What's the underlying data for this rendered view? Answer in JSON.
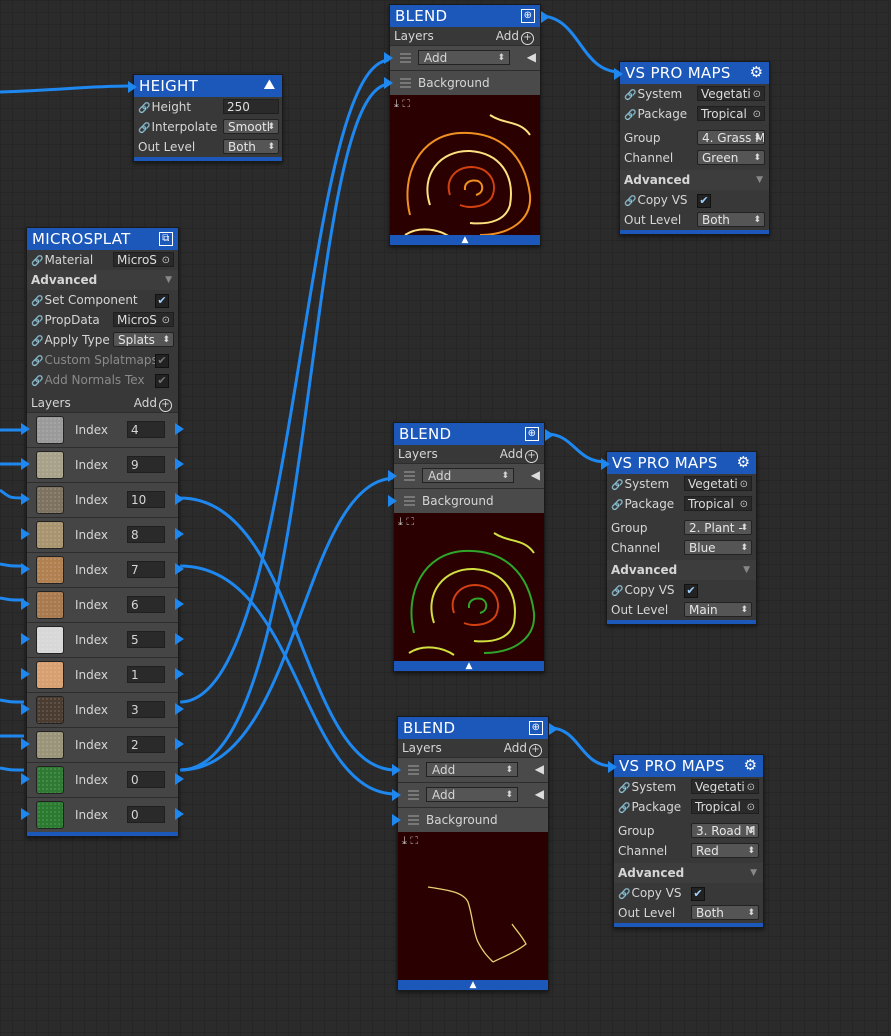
{
  "colors": {
    "accent": "#1b58ba",
    "wire": "#1e88f0",
    "canvas": "#2b2b2b"
  },
  "height_node": {
    "title": "HEIGHT",
    "height_label": "Height",
    "height_value": "250",
    "interpolate_label": "Interpolate",
    "interpolate_value": "Smootl",
    "outlevel_label": "Out Level",
    "outlevel_value": "Both"
  },
  "microsplat": {
    "title": "MICROSPLAT",
    "material_label": "Material",
    "material_value": "MicroS",
    "advanced_label": "Advanced",
    "set_component_label": "Set Component",
    "propdata_label": "PropData",
    "propdata_value": "MicroS",
    "apply_type_label": "Apply Type",
    "apply_type_value": "Splats",
    "custom_splatmaps_label": "Custom Splatmaps",
    "add_normals_label": "Add Normals Tex",
    "layers_label": "Layers",
    "add_label": "Add",
    "index_label": "Index",
    "layers": [
      {
        "index": "4",
        "color": "#9a9a9a"
      },
      {
        "index": "9",
        "color": "#a8a18a"
      },
      {
        "index": "10",
        "color": "#7d7260"
      },
      {
        "index": "8",
        "color": "#a8946e"
      },
      {
        "index": "7",
        "color": "#b08050"
      },
      {
        "index": "6",
        "color": "#a87a4e"
      },
      {
        "index": "5",
        "color": "#d8d8d8"
      },
      {
        "index": "1",
        "color": "#d8a070"
      },
      {
        "index": "3",
        "color": "#4a3c30"
      },
      {
        "index": "2",
        "color": "#9a9478"
      },
      {
        "index": "0",
        "color": "#2e7a32"
      },
      {
        "index": "0",
        "color": "#2a7a30"
      }
    ]
  },
  "blend_nodes": [
    {
      "title": "BLEND",
      "layers_label": "Layers",
      "add_label": "Add",
      "layer_rows": [
        "Add"
      ],
      "background_label": "Background"
    },
    {
      "title": "BLEND",
      "layers_label": "Layers",
      "add_label": "Add",
      "layer_rows": [
        "Add"
      ],
      "background_label": "Background"
    },
    {
      "title": "BLEND",
      "layers_label": "Layers",
      "add_label": "Add",
      "layer_rows": [
        "Add",
        "Add"
      ],
      "background_label": "Background"
    }
  ],
  "vs_nodes": [
    {
      "title": "VS PRO MAPS",
      "system_label": "System",
      "system_value": "Vegetati",
      "package_label": "Package",
      "package_value": "Tropical",
      "group_label": "Group",
      "group_value": "4. Grass M",
      "channel_label": "Channel",
      "channel_value": "Green",
      "advanced_label": "Advanced",
      "copy_label": "Copy VS",
      "outlevel_label": "Out Level",
      "outlevel_value": "Both"
    },
    {
      "title": "VS PRO MAPS",
      "system_label": "System",
      "system_value": "Vegetati",
      "package_label": "Package",
      "package_value": "Tropical",
      "group_label": "Group",
      "group_value": "2. Plant - ",
      "channel_label": "Channel",
      "channel_value": "Blue",
      "advanced_label": "Advanced",
      "copy_label": "Copy VS",
      "outlevel_label": "Out Level",
      "outlevel_value": "Main"
    },
    {
      "title": "VS PRO MAPS",
      "system_label": "System",
      "system_value": "Vegetati",
      "package_label": "Package",
      "package_value": "Tropical",
      "group_label": "Group",
      "group_value": "3. Road M",
      "channel_label": "Channel",
      "channel_value": "Red",
      "advanced_label": "Advanced",
      "copy_label": "Copy VS",
      "outlevel_label": "Out Level",
      "outlevel_value": "Both"
    }
  ]
}
